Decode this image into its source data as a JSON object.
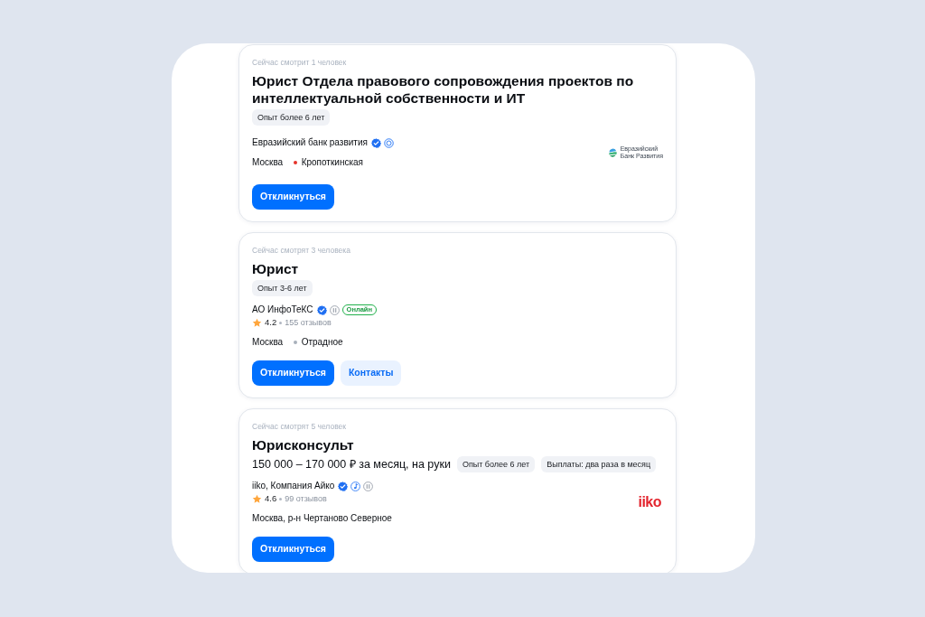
{
  "vacancies": [
    {
      "viewers": "Сейчас смотрит 1 человек",
      "title": "Юрист Отдела правового сопровождения проектов по интеллектуальной собственности и ИТ",
      "tags": [
        "Опыт более 6 лет"
      ],
      "company": {
        "name": "Евразийский банк развития",
        "badges": [
          {
            "kind": "verified"
          },
          {
            "kind": "rings"
          }
        ]
      },
      "location": {
        "city": "Москва",
        "metro": {
          "station": "Кропоткинская",
          "color": "#e5332a"
        }
      },
      "logo": {
        "kind": "eabr",
        "lines": [
          "Евразийский",
          "Банк Развития"
        ]
      },
      "buttons": [
        {
          "kind": "primary",
          "label": "Откликнуться"
        }
      ]
    },
    {
      "viewers": "Сейчас смотрят 3 человека",
      "title": "Юрист",
      "tags": [
        "Опыт 3-6 лет"
      ],
      "company": {
        "name": "АО ИнфоТеКС",
        "badges": [
          {
            "kind": "verified"
          },
          {
            "kind": "pause"
          },
          {
            "kind": "online",
            "label": "Онлайн"
          }
        ]
      },
      "rating": {
        "score": "4.2",
        "reviews": "155 отзывов"
      },
      "location": {
        "city": "Москва",
        "metro": {
          "station": "Отрадное",
          "color": "#a8b0bb"
        }
      },
      "buttons": [
        {
          "kind": "primary",
          "label": "Откликнуться"
        },
        {
          "kind": "secondary",
          "label": "Контакты"
        }
      ]
    },
    {
      "viewers": "Сейчас смотрят 5 человек",
      "title": "Юрисконсульт",
      "salary": "150 000 – 170 000 ₽ за месяц, на руки",
      "tags": [
        "Опыт более 6 лет",
        "Выплаты: два раза в месяц"
      ],
      "company": {
        "name": "iiko, Компания Айко",
        "badges": [
          {
            "kind": "verified"
          },
          {
            "kind": "note"
          },
          {
            "kind": "pause"
          }
        ]
      },
      "rating": {
        "score": "4.6",
        "reviews": "99 отзывов"
      },
      "location": {
        "city": "Москва, р-н Чертаново Северное"
      },
      "logo": {
        "kind": "iiko",
        "lines": [
          "iiko"
        ]
      },
      "buttons": [
        {
          "kind": "primary",
          "label": "Откликнуться"
        }
      ]
    }
  ]
}
